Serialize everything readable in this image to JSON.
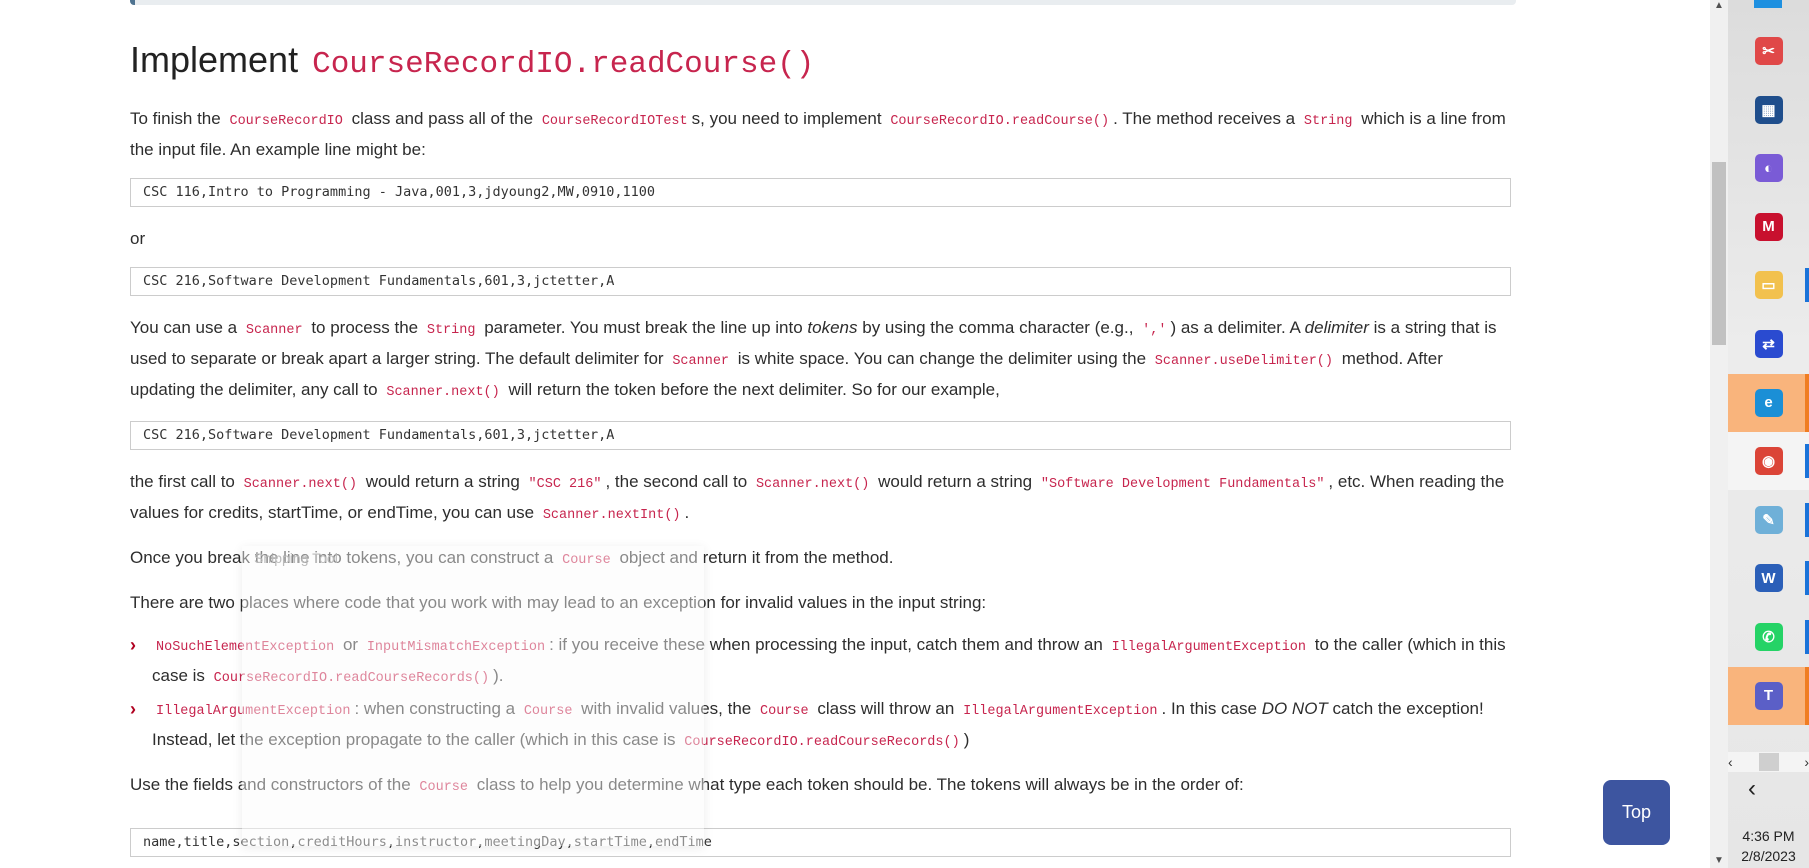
{
  "heading": {
    "prefix": "Implement",
    "code": "CourseRecordIO.readCourse()"
  },
  "p1": {
    "t1": "To finish the",
    "c1": "CourseRecordIO",
    "t2": "class and pass all of the",
    "c2": "CourseRecordIOTest",
    "t3": "s, you need to implement",
    "c3": "CourseRecordIO.readCourse()",
    "t4": ". The method receives a",
    "c4": "String",
    "t5": "which is a line from the input file. An example line might be:"
  },
  "example1": "CSC 116,Intro to Programming - Java,001,3,jdyoung2,MW,0910,1100",
  "or_text": "or",
  "example2": "CSC 216,Software Development Fundamentals,601,3,jctetter,A",
  "p2": {
    "t1": "You can use a",
    "c1": "Scanner",
    "t2": "to process the",
    "c2": "String",
    "t3": "parameter. You must break the line up into",
    "e1": "tokens",
    "t4": "by using the comma character (e.g.,",
    "c3": "','",
    "t5": ") as a delimiter. A",
    "e2": "delimiter",
    "t6": "is a string that is used to separate or break apart a larger string. The default delimiter for",
    "c4": "Scanner",
    "t7": "is white space. You can change the delimiter using the",
    "c5": "Scanner.useDelimiter()",
    "t8": "method. After updating the delimiter, any call to",
    "c6": "Scanner.next()",
    "t9": "will return the token before the next delimiter. So for our example,"
  },
  "example3": "CSC 216,Software Development Fundamentals,601,3,jctetter,A",
  "p3": {
    "t1": "the first call to",
    "c1": "Scanner.next()",
    "t2": "would return a string",
    "c2": "\"CSC 216\"",
    "t3": ", the second call to",
    "c3": "Scanner.next()",
    "t4": "would return a string",
    "c4": "\"Software Development Fundamentals\"",
    "t5": ", etc. When reading the values for credits, startTime, or endTime, you can use",
    "c5": "Scanner.nextInt()",
    "t6": "."
  },
  "p4": {
    "t1": "Once you break the line into tokens, you can construct a",
    "c1": "Course",
    "t2": "object and return it from the method."
  },
  "p5": "There are two places where code that you work with may lead to an exception for invalid values in the input string:",
  "list": [
    {
      "c1": "NoSuchElementException",
      "t1": "or",
      "c2": "InputMismatchException",
      "t2": ": if you receive these when processing the input, catch them and throw an",
      "c3": "IllegalArgumentException",
      "t3": "to the caller (which in this case is",
      "c4": "CourseRecordIO.readCourseRecords()",
      "t4": ")."
    },
    {
      "c1": "IllegalArgumentException",
      "t1": ": when constructing a",
      "c2": "Course",
      "t2": "with invalid values, the",
      "c3": "Course",
      "t3": "class will throw an",
      "c4": "IllegalArgumentException",
      "t4": ". In this case",
      "e1": "DO NOT",
      "t5": "catch the exception! Instead, let the exception propagate to the caller (which in this case is",
      "c5": "CourseRecordIO.readCourseRecords()",
      "t6": ")"
    }
  ],
  "p6": {
    "t1": "Use the fields and constructors of the",
    "c1": "Course",
    "t2": "class to help you determine what type each token should be. The tokens will always be in the order of:"
  },
  "example4": "name,title,section,creditHours,instructor,meetingDay,startTime,endTime",
  "overlay": {
    "title": "Snipping Tool"
  },
  "top_button": "Top",
  "taskbar": {
    "items": [
      {
        "name": "snipping-tool",
        "glyph": "✂",
        "color": "#e04848",
        "state": "normal"
      },
      {
        "name": "microsoft-store",
        "glyph": "▦",
        "color": "#1f4e8c",
        "state": "normal"
      },
      {
        "name": "microsoft-365",
        "glyph": "◐",
        "color": "#7a5bd6",
        "state": "normal"
      },
      {
        "name": "mcafee",
        "glyph": "M",
        "color": "#c8102e",
        "state": "normal"
      },
      {
        "name": "file-explorer",
        "glyph": "▭",
        "color": "#f2c14e",
        "state": "open"
      },
      {
        "name": "remote-desktop",
        "glyph": "⇄",
        "color": "#2a4bd0",
        "state": "normal"
      },
      {
        "name": "edge",
        "glyph": "e",
        "color": "#1b8fd6",
        "state": "active"
      },
      {
        "name": "chrome",
        "glyph": "◉",
        "color": "#db4437",
        "state": "hover"
      },
      {
        "name": "notepad",
        "glyph": "✎",
        "color": "#6fb0d8",
        "state": "open"
      },
      {
        "name": "word",
        "glyph": "W",
        "color": "#2b5fb8",
        "state": "open"
      },
      {
        "name": "whatsapp",
        "glyph": "✆",
        "color": "#25d366",
        "state": "open"
      },
      {
        "name": "teams",
        "glyph": "T",
        "color": "#5b5fc7",
        "state": "active"
      }
    ],
    "time": "4:36 PM",
    "date": "2/8/2023"
  }
}
